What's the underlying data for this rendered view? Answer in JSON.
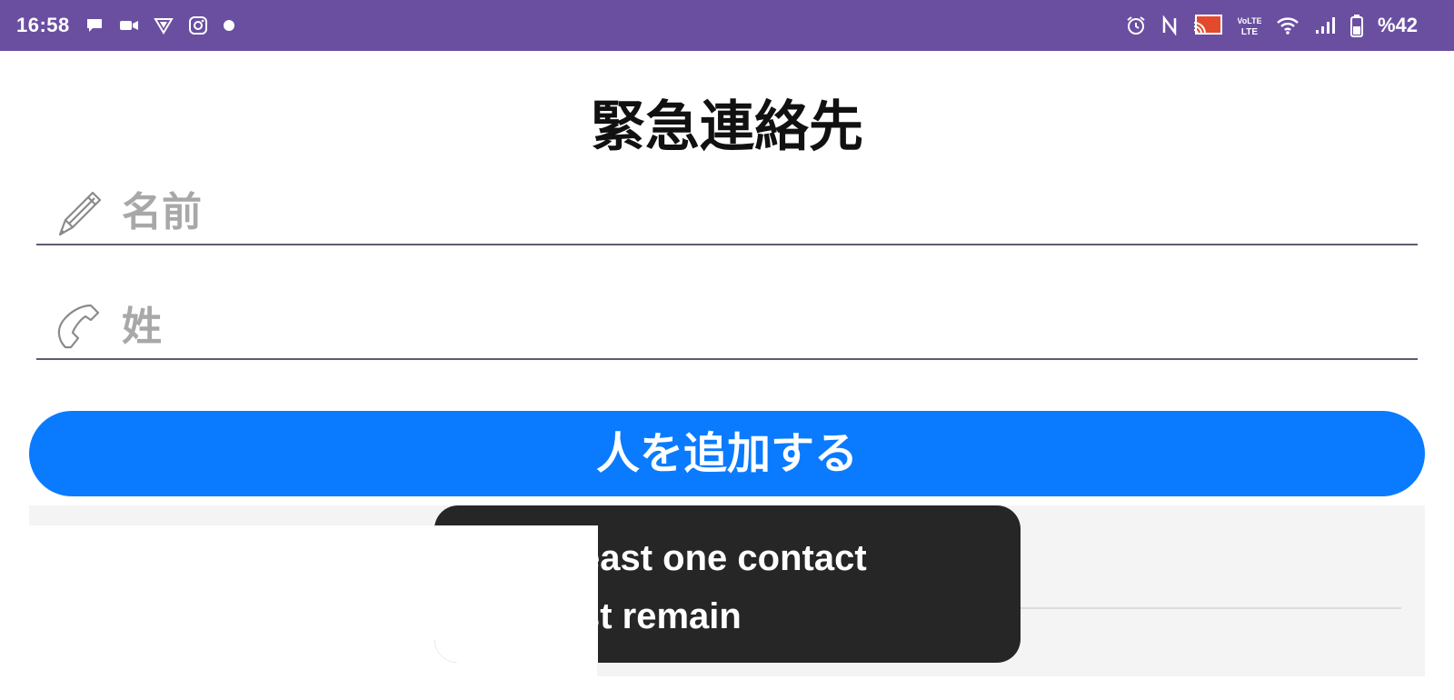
{
  "status_bar": {
    "time": "16:58",
    "left_icons": [
      "chat-bubble-icon",
      "video-camera-icon",
      "vpn-shield-icon",
      "instagram-icon",
      "dot-icon"
    ],
    "right_icons": [
      "alarm-icon",
      "nfc-icon",
      "cast-icon",
      "volte-icon",
      "wifi-icon",
      "signal-icon",
      "battery-icon"
    ],
    "volte_label": "VoLTE",
    "battery": "%42",
    "background": "#6a4fa1"
  },
  "page": {
    "title": "緊急連絡先"
  },
  "form": {
    "first_name": {
      "placeholder": "名前",
      "value": "",
      "icon": "pencil-icon"
    },
    "last_name": {
      "placeholder": "姓",
      "value": "",
      "icon": "phone-icon"
    },
    "add_button_label": "人を追加する",
    "accent_color": "#0a7bff"
  },
  "toast": {
    "line1": "east one contact",
    "line2": "st remain"
  }
}
